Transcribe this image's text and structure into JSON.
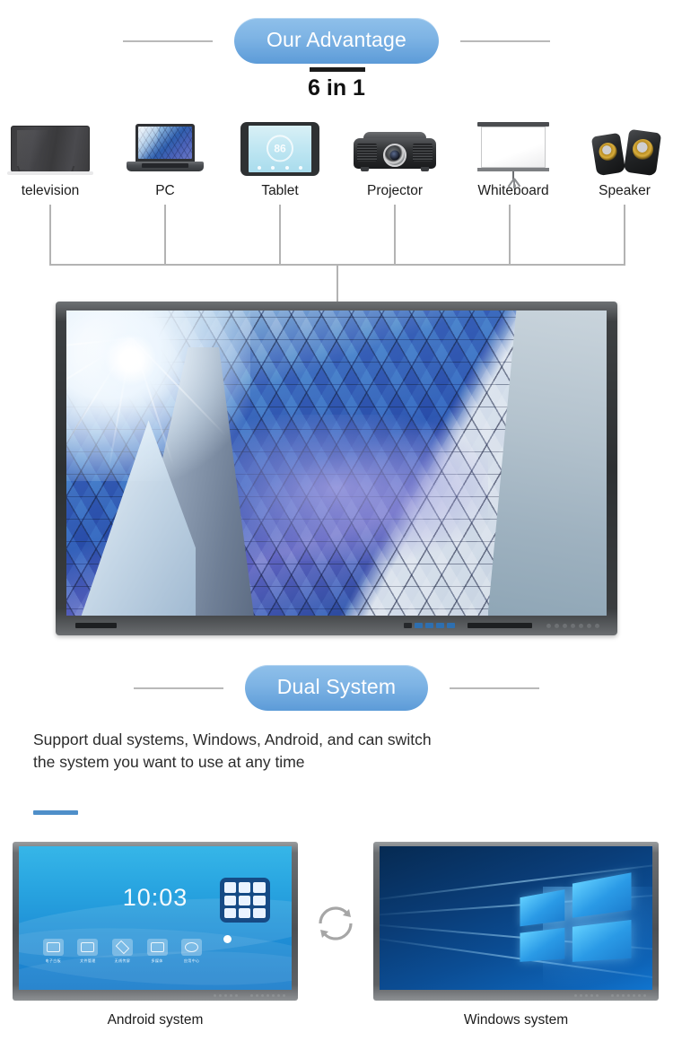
{
  "sections": {
    "advantage": {
      "pill_label": "Our Advantage",
      "subtitle": "6 in 1"
    },
    "dual": {
      "pill_label": "Dual System",
      "description": "Support dual systems, Windows, Android, and can switch the system you want to use at any time"
    }
  },
  "devices": [
    {
      "label": "television",
      "icon": "television-icon"
    },
    {
      "label": "PC",
      "icon": "laptop-icon"
    },
    {
      "label": "Tablet",
      "icon": "tablet-icon"
    },
    {
      "label": "Projector",
      "icon": "projector-icon"
    },
    {
      "label": "Whiteboard",
      "icon": "whiteboard-icon"
    },
    {
      "label": "Speaker",
      "icon": "speaker-icon"
    }
  ],
  "tablet": {
    "value": "86"
  },
  "android": {
    "clock": "10:03",
    "apps": [
      {
        "label": "电子白板"
      },
      {
        "label": "文件管理"
      },
      {
        "label": "无线传屏"
      },
      {
        "label": "多媒体"
      },
      {
        "label": "应用中心"
      }
    ]
  },
  "systems": [
    {
      "label": "Android system",
      "os": "android"
    },
    {
      "label": "Windows system",
      "os": "windows"
    }
  ],
  "switch_icon": "circular-arrows-icon",
  "colors": {
    "pill_top": "#8fc0ea",
    "pill_bottom": "#5c9bd8",
    "accent_bar": "#4f8fc9",
    "rule": "#b9b9b9",
    "tree_line": "#b3b3b3"
  }
}
